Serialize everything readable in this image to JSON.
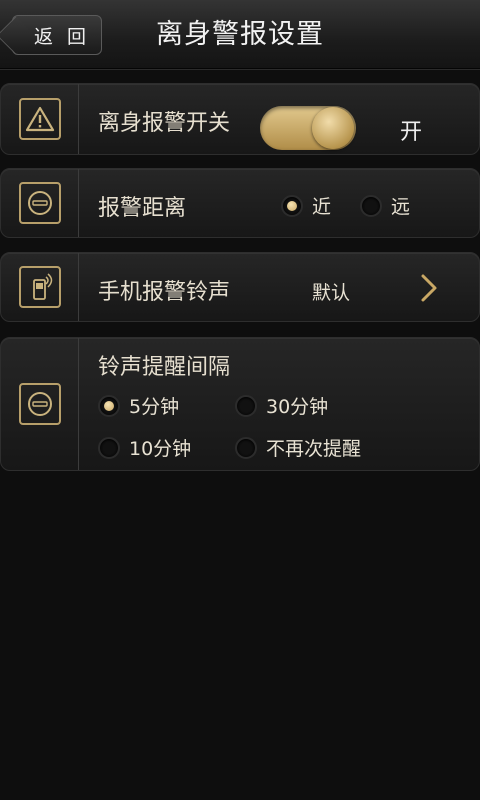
{
  "header": {
    "back_label": "返 回",
    "title": "离身警报设置"
  },
  "rows": {
    "alarm_switch": {
      "label": "离身报警开关",
      "toggle_on": true,
      "state_text": "开"
    },
    "distance": {
      "label": "报警距离",
      "options": [
        {
          "label": "近",
          "checked": true
        },
        {
          "label": "远",
          "checked": false
        }
      ]
    },
    "ringtone": {
      "label": "手机报警铃声",
      "value": "默认"
    },
    "interval": {
      "label": "铃声提醒间隔",
      "options": [
        {
          "label": "5分钟",
          "checked": true
        },
        {
          "label": "30分钟",
          "checked": false
        },
        {
          "label": "10分钟",
          "checked": false
        },
        {
          "label": "不再次提醒",
          "checked": false
        }
      ]
    }
  },
  "colors": {
    "accent_gold": "#c9a865",
    "background": "#0e0e0e"
  }
}
